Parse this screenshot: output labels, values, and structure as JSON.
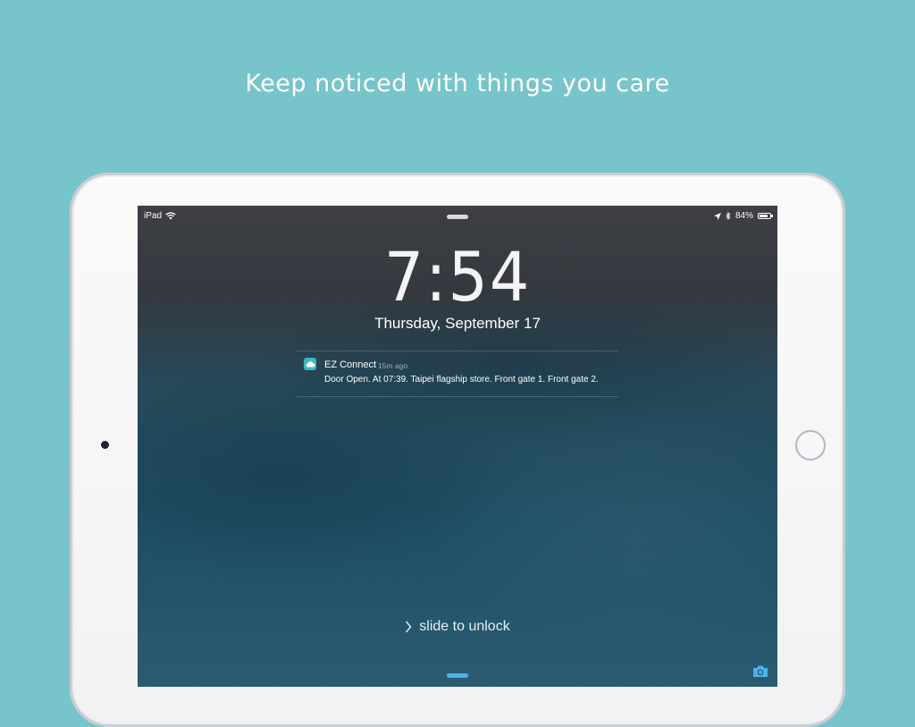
{
  "headline": "Keep noticed with things you care",
  "status_bar": {
    "device": "iPad",
    "battery": "84%",
    "battery_level": 0.84,
    "icons": [
      "wifi-icon",
      "location-arrow-icon",
      "bluetooth-icon",
      "battery-icon"
    ]
  },
  "lock_screen": {
    "time": "7:54",
    "date": "Thursday, September 17",
    "slide_text": "slide to unlock"
  },
  "notification": {
    "app_name": "EZ Connect",
    "time_ago": "15m ago",
    "body": "Door Open. At 07:39. Taipei flagship store. Front gate 1. Front gate 2.",
    "app_icon": "cloud-icon",
    "accent_color": "#3fb7c4"
  },
  "colors": {
    "background": "#77c5cb",
    "grabber_bottom": "#4fb2e6",
    "camera_icon": "#4fb2e6"
  }
}
